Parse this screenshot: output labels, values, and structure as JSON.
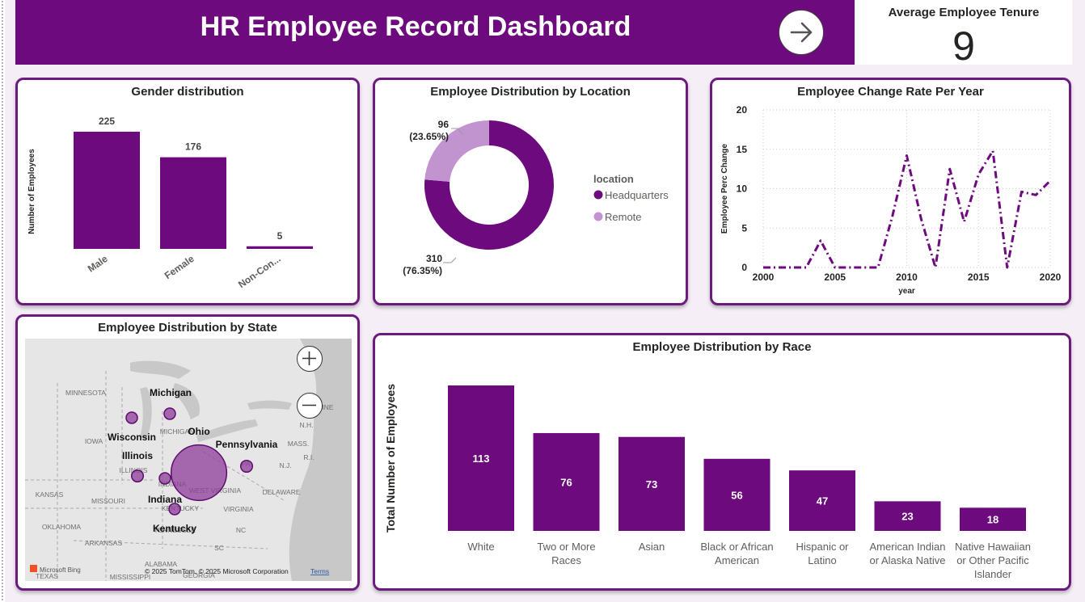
{
  "header": {
    "title": "HR Employee Record Dashboard"
  },
  "kpi": {
    "label": "Average Employee Tenure",
    "value": "9"
  },
  "colors": {
    "primary": "#6d0a7e",
    "secondary": "#c193cf",
    "page_bg": "#f5eef6"
  },
  "icons": {
    "nav": "arrow-right-icon",
    "zoom_in": "plus-icon",
    "zoom_out": "minus-icon"
  },
  "chart_data": [
    {
      "id": "gender",
      "type": "bar",
      "title": "Gender distribution",
      "ylabel": "Number of Employees",
      "xlabel": "",
      "categories": [
        "Male",
        "Female",
        "Non-Con..."
      ],
      "values": [
        225,
        176,
        5
      ],
      "ylim": [
        0,
        225
      ]
    },
    {
      "id": "location",
      "type": "pie",
      "subtype": "donut",
      "title": "Employee Distribution by Location",
      "legend_title": "location",
      "legend_position": "right",
      "slices": [
        {
          "name": "Headquarters",
          "value": 310,
          "percent": "76.35%",
          "color": "#6d0a7e"
        },
        {
          "name": "Remote",
          "value": 96,
          "percent": "23.65%",
          "color": "#c193cf"
        }
      ]
    },
    {
      "id": "change_rate",
      "type": "line",
      "title": "Employee Change Rate Per Year",
      "xlabel": "year",
      "ylabel": "Employee Perc Change",
      "xlim": [
        2000,
        2020
      ],
      "ylim": [
        0,
        20
      ],
      "xticks": [
        2000,
        2005,
        2010,
        2015,
        2020
      ],
      "yticks": [
        0,
        5,
        10,
        15,
        20
      ],
      "grid": true,
      "line_style": "dash-dot",
      "x": [
        2000,
        2001,
        2002,
        2003,
        2004,
        2005,
        2006,
        2007,
        2008,
        2009,
        2010,
        2011,
        2012,
        2013,
        2014,
        2015,
        2016,
        2017,
        2018,
        2019,
        2020
      ],
      "y": [
        0,
        0,
        0,
        0,
        3.4,
        0,
        0,
        0,
        0,
        6.5,
        14.2,
        6.2,
        0,
        12.5,
        5.8,
        11.8,
        14.8,
        0,
        9.6,
        9.2,
        11
      ]
    },
    {
      "id": "state",
      "type": "map",
      "title": "Employee Distribution by State",
      "bubbles": [
        {
          "name": "Ohio",
          "value": 310
        },
        {
          "name": "Michigan",
          "value": 12
        },
        {
          "name": "Pennsylvania",
          "value": 14
        },
        {
          "name": "Illinois",
          "value": 14
        },
        {
          "name": "Indiana",
          "value": 11
        },
        {
          "name": "Wisconsin",
          "value": 9
        },
        {
          "name": "Kentucky",
          "value": 9
        }
      ],
      "basemap_labels": [
        "MINNESOTA",
        "IOWA",
        "KANSAS",
        "MISSOURI",
        "OKLAHOMA",
        "ARKANSAS",
        "TEXAS",
        "MISSISSIPPI",
        "ALABAMA",
        "TENNESSEE",
        "SC",
        "NC",
        "VIRGINIA",
        "WEST VIRGINIA",
        "DELAWARE",
        "N.J.",
        "MASS.",
        "R.I.",
        "N.H.",
        "MAINE",
        "ILLINOIS",
        "INDIANA",
        "KENTUCKY",
        "MICHIGAN",
        "PA",
        "GEORGIA"
      ],
      "attribution": {
        "brand": "Microsoft Bing",
        "copyright": "© 2025 TomTom, © 2025 Microsoft Corporation",
        "terms": "Terms"
      }
    },
    {
      "id": "race",
      "type": "bar",
      "title": "Employee Distribution by Race",
      "ylabel": "Total Number of Employees",
      "xlabel": "",
      "categories": [
        "White",
        "Two or More Races",
        "Asian",
        "Black or African American",
        "Hispanic or Latino",
        "American Indian or Alaska Native",
        "Native Hawaiian or Other Pacific Islander"
      ],
      "category_lines": [
        [
          "White"
        ],
        [
          "Two or More",
          "Races"
        ],
        [
          "Asian"
        ],
        [
          "Black or African",
          "American"
        ],
        [
          "Hispanic or",
          "Latino"
        ],
        [
          "American Indian",
          "or Alaska Native"
        ],
        [
          "Native Hawaiian",
          "or Other Pacific",
          "Islander"
        ]
      ],
      "values": [
        113,
        76,
        73,
        56,
        47,
        23,
        18
      ],
      "ylim": [
        0,
        113
      ]
    }
  ]
}
